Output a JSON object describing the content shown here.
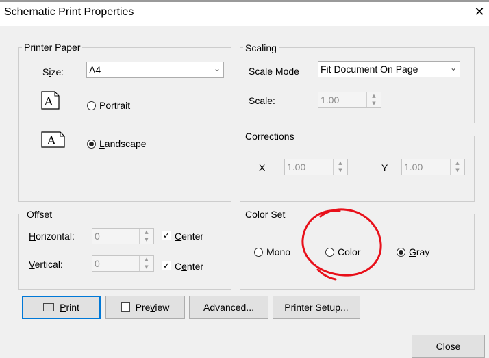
{
  "window": {
    "title": "Schematic Print Properties",
    "close_glyph": "✕"
  },
  "printer_paper": {
    "label": "Printer Paper",
    "size_prefix": "S",
    "size_ul": "i",
    "size_suffix": "ze:",
    "size_value": "A4",
    "portrait_pre": "Por",
    "portrait_ul": "t",
    "portrait_post": "rait",
    "landscape_ul": "L",
    "landscape_post": "andscape",
    "icon_glyph": "A",
    "orientation": "landscape"
  },
  "offset": {
    "label": "Offset",
    "h_ul": "H",
    "h_post": "orizontal:",
    "v_ul": "V",
    "v_post": "ertical:",
    "h_value": "0",
    "v_value": "0",
    "center_ul": "C",
    "center_post": "enter",
    "center2_pre": "C",
    "center2_ul": "e",
    "center2_post": "nter",
    "check_glyph": "✓"
  },
  "scaling": {
    "label": "Scaling",
    "mode_label": "Scale Mode",
    "mode_value": "Fit Document On Page",
    "scale_ul": "S",
    "scale_post": "cale:",
    "scale_value": "1.00"
  },
  "corrections": {
    "label": "Corrections",
    "x_label": "X",
    "x_value": "1.00",
    "y_label": "Y",
    "y_value": "1.00"
  },
  "color_set": {
    "label": "Color Set",
    "mono": "Mono",
    "color": "Color",
    "gray_ul": "G",
    "gray_post": "ray",
    "selected": "gray",
    "annotation_color": "#e8101a"
  },
  "buttons": {
    "print_ul": "P",
    "print_post": "rint",
    "preview_pre": "Pre",
    "preview_ul": "v",
    "preview_post": "iew",
    "advanced": "Advanced...",
    "printer_setup": "Printer Setup...",
    "close": "Close"
  },
  "icons": {
    "dropdown": "chevron-down-icon",
    "spin": "spin-arrows-icon",
    "print": "printer-icon",
    "preview": "preview-icon",
    "paper": "page-icon"
  }
}
